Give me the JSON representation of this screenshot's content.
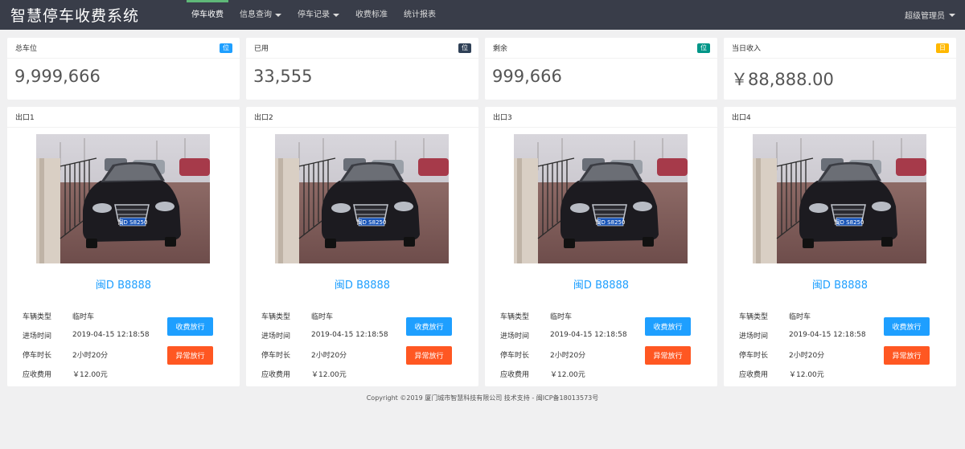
{
  "header": {
    "title": "智慧停车收费系统",
    "nav": [
      {
        "label": "停车收费",
        "active": true,
        "dropdown": false
      },
      {
        "label": "信息查询",
        "active": false,
        "dropdown": true
      },
      {
        "label": "停车记录",
        "active": false,
        "dropdown": true
      },
      {
        "label": "收费标准",
        "active": false,
        "dropdown": false
      },
      {
        "label": "统计报表",
        "active": false,
        "dropdown": false
      }
    ],
    "user": "超级管理员"
  },
  "stats": [
    {
      "label": "总车位",
      "badge": "位",
      "badge_color": "#1e9fff",
      "value": "9,999,666"
    },
    {
      "label": "已用",
      "badge": "位",
      "badge_color": "#2f4056",
      "value": "33,555"
    },
    {
      "label": "剩余",
      "badge": "位",
      "badge_color": "#009688",
      "value": "999,666"
    },
    {
      "label": "当日收入",
      "badge": "日",
      "badge_color": "#ffb800",
      "value": "￥88,888.00"
    }
  ],
  "exits": [
    {
      "title": "出口1",
      "plate": "闽D B8888",
      "plate_on_car": "闽D S8250",
      "rows": [
        [
          "车辆类型",
          "临时车"
        ],
        [
          "进场时间",
          "2019-04-15 12:18:58"
        ],
        [
          "停车时长",
          "2小时20分"
        ],
        [
          "应收费用",
          "￥12.00元"
        ]
      ],
      "pay_label": "收费放行",
      "abnormal_label": "异常放行"
    },
    {
      "title": "出口2",
      "plate": "闽D B8888",
      "plate_on_car": "闽D S8250",
      "rows": [
        [
          "车辆类型",
          "临时车"
        ],
        [
          "进场时间",
          "2019-04-15 12:18:58"
        ],
        [
          "停车时长",
          "2小时20分"
        ],
        [
          "应收费用",
          "￥12.00元"
        ]
      ],
      "pay_label": "收费放行",
      "abnormal_label": "异常放行"
    },
    {
      "title": "出口3",
      "plate": "闽D B8888",
      "plate_on_car": "闽D S8250",
      "rows": [
        [
          "车辆类型",
          "临时车"
        ],
        [
          "进场时间",
          "2019-04-15 12:18:58"
        ],
        [
          "停车时长",
          "2小时20分"
        ],
        [
          "应收费用",
          "￥12.00元"
        ]
      ],
      "pay_label": "收费放行",
      "abnormal_label": "异常放行"
    },
    {
      "title": "出口4",
      "plate": "闽D B8888",
      "plate_on_car": "闽D S8250",
      "rows": [
        [
          "车辆类型",
          "临时车"
        ],
        [
          "进场时间",
          "2019-04-15 12:18:58"
        ],
        [
          "停车时长",
          "2小时20分"
        ],
        [
          "应收费用",
          "￥12.00元"
        ]
      ],
      "pay_label": "收费放行",
      "abnormal_label": "异常放行"
    }
  ],
  "footer": "Copyright ©2019 厦门城市智慧科技有限公司 技术支持 - 闽ICP备18013573号"
}
